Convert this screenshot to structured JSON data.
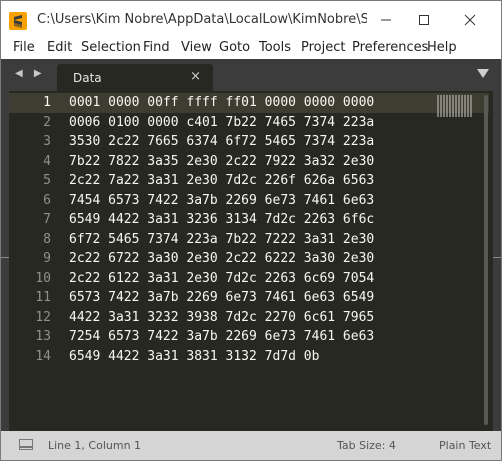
{
  "window": {
    "title": "C:\\Users\\Kim Nobre\\AppData\\LocalLow\\KimNobre\\Super ..."
  },
  "menu": [
    "File",
    "Edit",
    "Selection",
    "Find",
    "View",
    "Goto",
    "Tools",
    "Project",
    "Preferences",
    "Help"
  ],
  "tab": {
    "label": "Data",
    "close": "×"
  },
  "nav": {
    "arrows": "◀ ▶"
  },
  "editor": {
    "line_numbers": [
      "1",
      "2",
      "3",
      "4",
      "5",
      "6",
      "7",
      "8",
      "9",
      "10",
      "11",
      "12",
      "13",
      "14"
    ],
    "lines": [
      "0001 0000 00ff ffff ff01 0000 0000 0000",
      "0006 0100 0000 c401 7b22 7465 7374 223a",
      "3530 2c22 7665 6374 6f72 5465 7374 223a",
      "7b22 7822 3a35 2e30 2c22 7922 3a32 2e30",
      "2c22 7a22 3a31 2e30 7d2c 226f 626a 6563",
      "7454 6573 7422 3a7b 2269 6e73 7461 6e63",
      "6549 4422 3a31 3236 3134 7d2c 2263 6f6c",
      "6f72 5465 7374 223a 7b22 7222 3a31 2e30",
      "2c22 6722 3a30 2e30 2c22 6222 3a30 2e30",
      "2c22 6122 3a31 2e30 7d2c 2263 6c69 7054",
      "6573 7422 3a7b 2269 6e73 7461 6e63 6549",
      "4422 3a31 3232 3938 7d2c 2270 6c61 7965",
      "7254 6573 7422 3a7b 2269 6e73 7461 6e63",
      "6549 4422 3a31 3831 3132 7d7d 0b"
    ]
  },
  "status": {
    "position": "Line 1, Column 1",
    "tab_size": "Tab Size: 4",
    "syntax": "Plain Text"
  },
  "colors": {
    "editor_bg": "#272822",
    "chrome_bg": "#3c3c3c",
    "status_bg": "#d5d5d5",
    "app_icon": "#f7a200"
  }
}
